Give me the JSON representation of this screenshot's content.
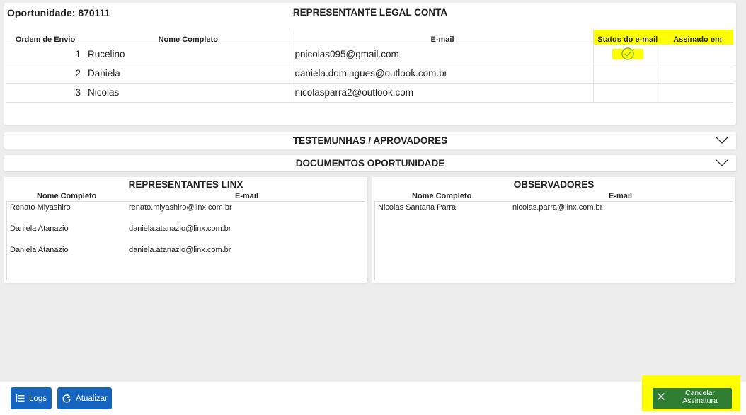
{
  "opportunity": {
    "label": "Oportunidade: 870111"
  },
  "legal_section": {
    "title": "REPRESENTANTE LEGAL CONTA",
    "columns": {
      "ordem": "Ordem de Envio",
      "nome": "Nome Completo",
      "email": "E-mail",
      "status": "Status do e-mail",
      "assinado": "Assinado em"
    },
    "rows": [
      {
        "ordem": "1",
        "nome": "Rucelino",
        "email": "pnicolas095@gmail.com",
        "status": "check-circle-icon",
        "assinado": ""
      },
      {
        "ordem": "2",
        "nome": "Daniela",
        "email": "daniela.domingues@outlook.com.br",
        "status": "",
        "assinado": ""
      },
      {
        "ordem": "3",
        "nome": "Nicolas",
        "email": "nicolasparra2@outlook.com",
        "status": "",
        "assinado": ""
      }
    ]
  },
  "accordions": {
    "testemunhas": {
      "label": "TESTEMUNHAS / APROVADORES",
      "icon": "chevron-down-icon"
    },
    "documentos": {
      "label": "DOCUMENTOS OPORTUNIDADE",
      "icon": "chevron-down-icon"
    }
  },
  "linx": {
    "title": "REPRESENTANTES LINX",
    "col_nome": "Nome Completo",
    "col_email": "E-mail",
    "rows": [
      {
        "nome": "Renato Miyashiro",
        "email": "renato.miyashiro@linx.com.br"
      },
      {
        "nome": "Daniela Atanazio",
        "email": "daniela.atanazio@linx.com.br"
      },
      {
        "nome": "Daniela Atanazio",
        "email": "daniela.atanazio@linx.com.br"
      }
    ]
  },
  "observadores": {
    "title": "OBSERVADORES",
    "col_nome": "Nome Completo",
    "col_email": "E-mail",
    "rows": [
      {
        "nome": "Nicolas Santana Parra",
        "email": "nicolas.parra@linx.com.br"
      }
    ]
  },
  "footer": {
    "logs_label": "Logs",
    "atualizar_label": "Atualizar",
    "cancel_line1": "Cancelar",
    "cancel_line2": "Assinatura"
  },
  "colors": {
    "highlight": "#ffff00",
    "primary_button": "#1565c0",
    "cancel_button": "#2e7d32",
    "check_green": "#7cb342"
  }
}
